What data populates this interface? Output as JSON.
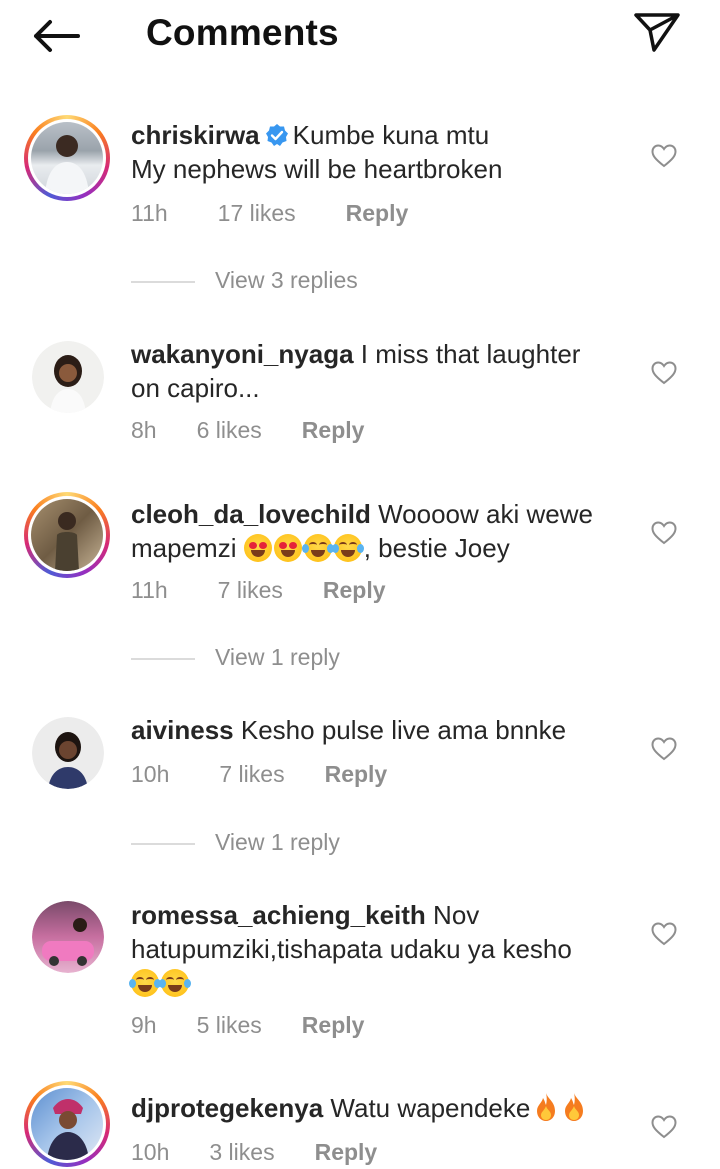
{
  "header": {
    "title": "Comments"
  },
  "comments": [
    {
      "username": "chriskirwa",
      "verified": true,
      "text": "Kumbe kuna mtu\nMy nephews will be heartbroken",
      "time": "11h",
      "likes": "17 likes",
      "reply": "Reply",
      "view_replies": "View 3 replies"
    },
    {
      "username": "wakanyoni_nyaga",
      "text": "I miss that laughter on capiro...",
      "time": "8h",
      "likes": "6 likes",
      "reply": "Reply"
    },
    {
      "username": "cleoh_da_lovechild",
      "text_before": "Woooow aki wewe mapemzi",
      "emojis": [
        "heart-eyes",
        "heart-eyes",
        "tears-of-joy",
        "tears-of-joy"
      ],
      "text_after": ", bestie Joey",
      "time": "11h",
      "likes": "7 likes",
      "reply": "Reply",
      "view_replies": "View 1 reply"
    },
    {
      "username": "aiviness",
      "text": "Kesho pulse live ama bnnke",
      "time": "10h",
      "likes": "7 likes",
      "reply": "Reply",
      "view_replies": "View 1 reply"
    },
    {
      "username": "romessa_achieng_keith",
      "text": "Nov hatupumziki,tishapata udaku ya kesho",
      "emojis": [
        "tears-of-joy",
        "tears-of-joy"
      ],
      "time": "9h",
      "likes": "5 likes",
      "reply": "Reply"
    },
    {
      "username": "djprotegekenya",
      "text": "Watu wapendeke",
      "emojis": [
        "fire",
        "fire"
      ],
      "time": "10h",
      "likes": "3 likes",
      "reply": "Reply"
    }
  ]
}
